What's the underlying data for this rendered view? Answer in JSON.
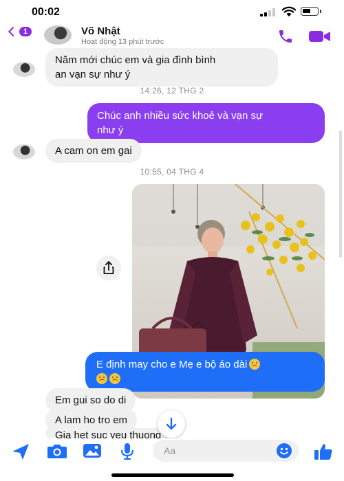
{
  "status_bar": {
    "time": "00:02"
  },
  "header": {
    "back_badge": "1",
    "name": "Võ Nhật",
    "active_status": "Hoạt động 13 phút trước",
    "accent_color": "#8a2be2"
  },
  "messages": {
    "m1_line1": "Năm mới chúc em và gia đình bình",
    "m1_line2": "an vạn sự như ý",
    "stamp1": "14:26, 12 THG 2",
    "m2_line1": "Chúc anh nhiều sức khoẻ và vạn sự",
    "m2_line2": "như ý",
    "m3": "A cam on em gai",
    "stamp2": "10:55, 04 THG 4",
    "m4_line1": "E định may cho e Mẹ e bộ áo dài",
    "m5": "Em gui so do di",
    "m6": "A lam ho tro em",
    "m7": "Gia het suc yeu thuong"
  },
  "composer": {
    "placeholder": "Aa"
  },
  "colors": {
    "outgoing_bubble": "#8a3ef0",
    "outgoing_bubble_blue": "#1f6ef7",
    "incoming_bubble": "#f0f0f0",
    "composer_icons": "#1f6ef7"
  },
  "icons": [
    "signal-icon",
    "wifi-icon",
    "battery-icon",
    "back-chevron-icon",
    "phone-icon",
    "video-camera-icon",
    "share-icon",
    "arrow-down-icon",
    "send-location-icon",
    "camera-icon",
    "gallery-icon",
    "microphone-icon",
    "emoji-icon",
    "thumbs-up-icon"
  ]
}
